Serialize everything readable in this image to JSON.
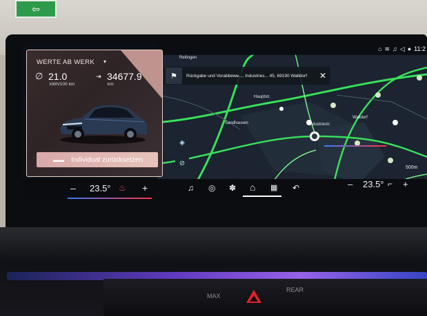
{
  "environment": {
    "exit_sign": "⇦",
    "climate": {
      "max_label": "MAX",
      "rear_label": "REAR"
    }
  },
  "status_bar": {
    "icons": [
      "home-icon",
      "wifi-icon",
      "music-note-icon",
      "volume-icon",
      "mic-icon"
    ],
    "clock": "11:2"
  },
  "navigation": {
    "destination": "Rückgabe und Vorabbewe..., Industries... 45, 69190 Walldorf",
    "close_label": "✕",
    "place_labels": [
      "Hauptstr.",
      "Reilingen",
      "Walldorf",
      "Industriestr.",
      "Sandhausen"
    ],
    "scale_label": "500m"
  },
  "vehicle_card": {
    "title": "WERTE AB WERK",
    "consumption_value": "21.0",
    "consumption_unit": "kWh/100 km",
    "range_value": "34677.9",
    "range_unit": "km",
    "reset_label": "Individual zurücksetzen"
  },
  "climate_bar": {
    "left_minus": "–",
    "left_temp": "23.5°",
    "left_plus": "+",
    "right_minus": "–",
    "right_temp": "23.5°",
    "right_plus": "+"
  },
  "dock": {
    "items": [
      "music-icon",
      "navigation-icon",
      "fan-icon",
      "home-icon",
      "apps-icon",
      "phone-icon"
    ]
  },
  "colors": {
    "road_primary": "#39e05a",
    "road_secondary": "#7bf08a",
    "card_accent": "#d8a7a0",
    "temp_line_cold": "#3a7cff",
    "temp_line_hot": "#ff3344",
    "hazard": "#e2222d"
  }
}
